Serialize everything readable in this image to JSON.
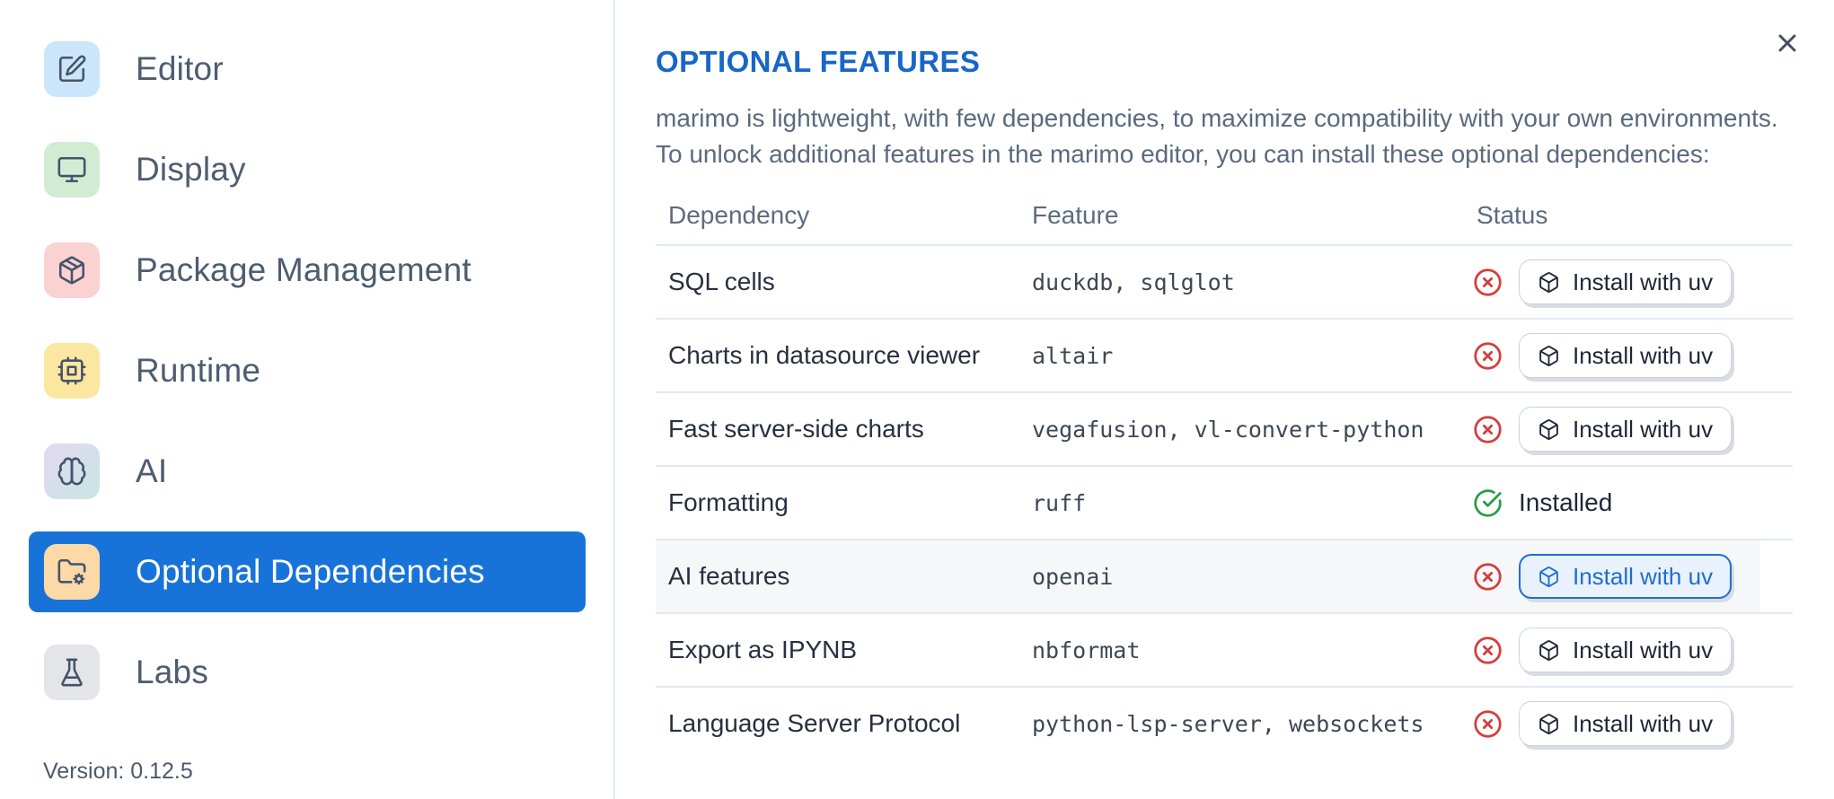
{
  "sidebar": {
    "items": [
      {
        "label": "Editor",
        "icon": "edit-icon",
        "tile_color": "#cbe6fa"
      },
      {
        "label": "Display",
        "icon": "monitor-icon",
        "tile_color": "#d2ecd3"
      },
      {
        "label": "Package Management",
        "icon": "package-icon",
        "tile_color": "#fad2d2"
      },
      {
        "label": "Runtime",
        "icon": "cpu-icon",
        "tile_color": "#fbe7a0"
      },
      {
        "label": "AI",
        "icon": "brain-icon",
        "tile_gradient": [
          "#e3d8f1",
          "#c7e6e3"
        ]
      },
      {
        "label": "Optional Dependencies",
        "icon": "folder-cog-icon",
        "tile_color": "#fcd9a6",
        "selected": true
      },
      {
        "label": "Labs",
        "icon": "flask-icon",
        "tile_color": "#e4e5e8"
      }
    ],
    "version_label": "Version: 0.12.5"
  },
  "panel": {
    "title": "OPTIONAL FEATURES",
    "description_lines": [
      "marimo is lightweight, with few dependencies, to maximize compatibility with your own environments.",
      "To unlock additional features in the marimo editor, you can install these optional dependencies:"
    ],
    "close_icon": "x-icon"
  },
  "table": {
    "headers": [
      "Dependency",
      "Feature",
      "Status"
    ],
    "rows": [
      {
        "dependency": "SQL cells",
        "feature": "duckdb, sqlglot",
        "status": "missing",
        "action_label": "Install with uv"
      },
      {
        "dependency": "Charts in datasource viewer",
        "feature": "altair",
        "status": "missing",
        "action_label": "Install with uv"
      },
      {
        "dependency": "Fast server-side charts",
        "feature": "vegafusion, vl-convert-python",
        "status": "missing",
        "action_label": "Install with uv"
      },
      {
        "dependency": "Formatting",
        "feature": "ruff",
        "status": "installed",
        "installed_label": "Installed"
      },
      {
        "dependency": "AI features",
        "feature": "openai",
        "status": "missing",
        "action_label": "Install with uv",
        "highlighted": true,
        "action_focused": true
      },
      {
        "dependency": "Export as IPYNB",
        "feature": "nbformat",
        "status": "missing",
        "action_label": "Install with uv"
      },
      {
        "dependency": "Language Server Protocol",
        "feature": "python-lsp-server, websockets",
        "status": "missing",
        "action_label": "Install with uv"
      }
    ]
  },
  "colors": {
    "accent_blue": "#1873d9",
    "title_blue": "#1866c6",
    "status_missing_red": "#d53d3d",
    "status_installed_green": "#2d9b43",
    "row_highlight": "#f6f7f9",
    "divider": "#e4e8ee"
  }
}
